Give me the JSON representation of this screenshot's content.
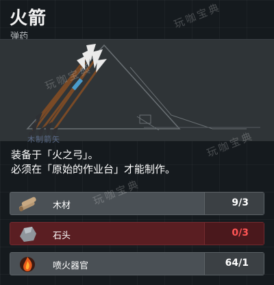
{
  "item": {
    "name": "火箭",
    "category": "弹药",
    "sub_label": "木制箭矢",
    "description": [
      "装备于「火之弓」。",
      "必须在「原始的作业台」才能制作。"
    ]
  },
  "watermark": "玩咖宝典",
  "materials": [
    {
      "name": "木材",
      "icon": "wood-icon",
      "count": "9/3",
      "sufficient": true
    },
    {
      "name": "石头",
      "icon": "stone-icon",
      "count": "0/3",
      "sufficient": false
    },
    {
      "name": "喷火器官",
      "icon": "flame-organ-icon",
      "count": "64/1",
      "sufficient": true
    }
  ],
  "colors": {
    "background": "#151a1e",
    "row_normal": "#4a5055",
    "row_insufficient": "#5a1e22",
    "insufficient_text": "#ff5555"
  }
}
